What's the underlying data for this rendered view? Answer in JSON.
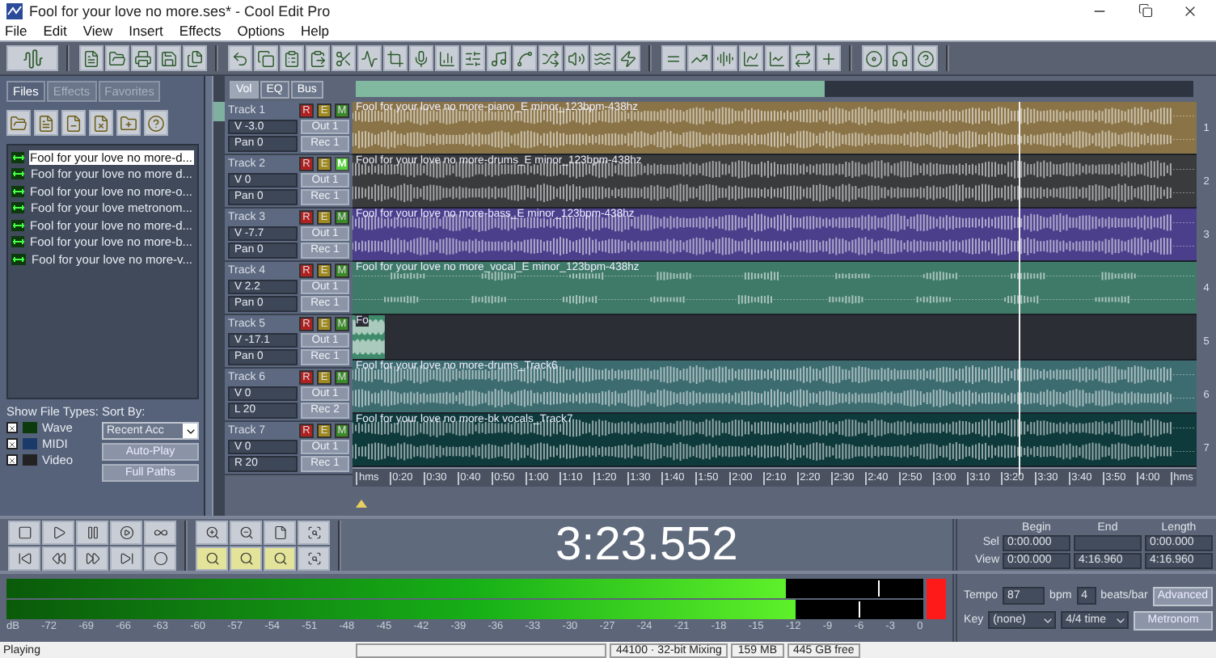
{
  "window": {
    "title": "Fool for your love no more.ses* - Cool Edit Pro"
  },
  "menu": [
    "File",
    "Edit",
    "View",
    "Insert",
    "Effects",
    "Options",
    "Help"
  ],
  "left_panel": {
    "tabs": [
      {
        "label": "Files",
        "selected": true
      },
      {
        "label": "Effects",
        "selected": false
      },
      {
        "label": "Favorites",
        "selected": false
      }
    ],
    "files": [
      {
        "name": "Fool for your love no more-d...",
        "selected": true
      },
      {
        "name": "Fool for your love no more d...",
        "selected": false
      },
      {
        "name": "Fool for your love no more-o...",
        "selected": false
      },
      {
        "name": "Fool for your love metronom...",
        "selected": false
      },
      {
        "name": "Fool for your love no more-d...",
        "selected": false
      },
      {
        "name": "Fool for your love no more-b...",
        "selected": false
      },
      {
        "name": "Fool for your love no more-v...",
        "selected": false
      }
    ],
    "show_file_types_label": "Show File Types:",
    "file_types": [
      {
        "label": "Wave",
        "checked": true
      },
      {
        "label": "MIDI",
        "checked": true
      },
      {
        "label": "Video",
        "checked": true
      }
    ],
    "sort_by_label": "Sort By:",
    "sort_by": "Recent Acc",
    "buttons": [
      "Auto-Play",
      "Full Paths"
    ]
  },
  "track_tabs": [
    {
      "label": "Vol",
      "selected": true
    },
    {
      "label": "EQ",
      "selected": false
    },
    {
      "label": "Bus",
      "selected": false
    }
  ],
  "tracks": [
    {
      "name": "Track 1",
      "switches": [
        {
          "label": "R",
          "on": false
        },
        {
          "label": "E",
          "on": false
        },
        {
          "label": "M",
          "on": false
        }
      ],
      "volume": "V -3.0",
      "pan": "Pan 0",
      "out": "Out 1",
      "rec": "Rec 1",
      "color": "#8a7447",
      "clip": {
        "label": "Fool for your love no more-piano_E minor_123bpm-438hz",
        "kind": "dense"
      }
    },
    {
      "name": "Track 2",
      "switches": [
        {
          "label": "R",
          "on": false
        },
        {
          "label": "E",
          "on": false
        },
        {
          "label": "M",
          "on": true
        }
      ],
      "volume": "V 0",
      "pan": "Pan 0",
      "out": "Out 1",
      "rec": "Rec 1",
      "color": "#3a3b3d",
      "clip": {
        "label": "Fool for your love no more-drums_E minor_123bpm-438hz",
        "kind": "dense"
      }
    },
    {
      "name": "Track 3",
      "switches": [
        {
          "label": "R",
          "on": false
        },
        {
          "label": "E",
          "on": false
        },
        {
          "label": "M",
          "on": false
        }
      ],
      "volume": "V -7.7",
      "pan": "Pan 0",
      "out": "Out 1",
      "rec": "Rec 1",
      "color": "#4b3f8c",
      "clip": {
        "label": "Fool for your love no more-bass_E minor_123bpm-438hz",
        "kind": "dense"
      }
    },
    {
      "name": "Track 4",
      "switches": [
        {
          "label": "R",
          "on": false
        },
        {
          "label": "E",
          "on": false
        },
        {
          "label": "M",
          "on": false
        }
      ],
      "volume": "V 2.2",
      "pan": "Pan 0",
      "out": "Out 1",
      "rec": "Rec 1",
      "color": "#3f7a68",
      "clip": {
        "label": "Fool for your love no more_vocal_E minor_123bpm-438hz",
        "kind": "sparse"
      }
    },
    {
      "name": "Track 5",
      "switches": [
        {
          "label": "R",
          "on": false
        },
        {
          "label": "E",
          "on": false
        },
        {
          "label": "M",
          "on": false
        }
      ],
      "volume": "V -17.1",
      "pan": "Pan 0",
      "out": "Out 1",
      "rec": "Rec 1",
      "color": "#3f8a6a",
      "clip": {
        "label": "Fo",
        "kind": "short"
      }
    },
    {
      "name": "Track 6",
      "switches": [
        {
          "label": "R",
          "on": false
        },
        {
          "label": "E",
          "on": false
        },
        {
          "label": "M",
          "on": false
        }
      ],
      "volume": "V 0",
      "pan": "L 20",
      "out": "Out 1",
      "rec": "Rec 2",
      "color": "#3d6c70",
      "clip": {
        "label": "Fool for your love no more-drums_Track6",
        "kind": "dense"
      }
    },
    {
      "name": "Track 7",
      "switches": [
        {
          "label": "R",
          "on": false
        },
        {
          "label": "E",
          "on": false
        },
        {
          "label": "M",
          "on": false
        }
      ],
      "volume": "V 0",
      "pan": "R 20",
      "out": "Out 1",
      "rec": "Rec 1",
      "color": "#0f3a3c",
      "clip": {
        "label": "Fool for your love no more-bk vocals_Track7",
        "kind": "dense"
      }
    }
  ],
  "playhead": {
    "level": 0.79
  },
  "ruler": [
    "hms",
    "0:20",
    "0:30",
    "0:40",
    "0:50",
    "1:00",
    "1:10",
    "1:20",
    "1:30",
    "1:40",
    "1:50",
    "2:00",
    "2:10",
    "2:20",
    "2:30",
    "2:40",
    "2:50",
    "3:00",
    "3:10",
    "3:20",
    "3:30",
    "3:40",
    "3:50",
    "4:00",
    "hms"
  ],
  "track_numbers": [
    "1",
    "2",
    "3",
    "4",
    "5",
    "6",
    "7"
  ],
  "time_display": "3:23.552",
  "selection": {
    "columns": [
      "Begin",
      "End",
      "Length"
    ],
    "rows": [
      {
        "label": "Sel",
        "begin": "0:00.000",
        "length": "0:00.000"
      },
      {
        "label": "View",
        "begin": "0:00.000",
        "end": "4:16.960",
        "length": "4:16.960"
      }
    ]
  },
  "meter": {
    "channels": [
      {
        "level": 0.85,
        "peak": {
          "level": 0.95
        }
      },
      {
        "level": 0.86,
        "peak": {
          "level": 0.93
        }
      }
    ],
    "clipped": true,
    "scale": [
      "dB",
      "-72",
      "-69",
      "-66",
      "-63",
      "-60",
      "-57",
      "-54",
      "-51",
      "-48",
      "-45",
      "-42",
      "-39",
      "-36",
      "-33",
      "-30",
      "-27",
      "-24",
      "-21",
      "-18",
      "-15",
      "-12",
      "-9",
      "-6",
      "-3",
      "0"
    ]
  },
  "tempo": {
    "tempo_label": "Tempo",
    "tempo": "87",
    "bpm_label": "bpm",
    "beats": "4",
    "beats_label": "beats/bar",
    "advanced": "Advanced",
    "key_label": "Key",
    "key": "(none)",
    "time_sig": "4/4 time",
    "metronome": "Metronom"
  },
  "status_bar": {
    "message": "Playing",
    "cells": [
      "44100 · 32-bit Mixing",
      "159 MB",
      "445 GB free"
    ]
  }
}
